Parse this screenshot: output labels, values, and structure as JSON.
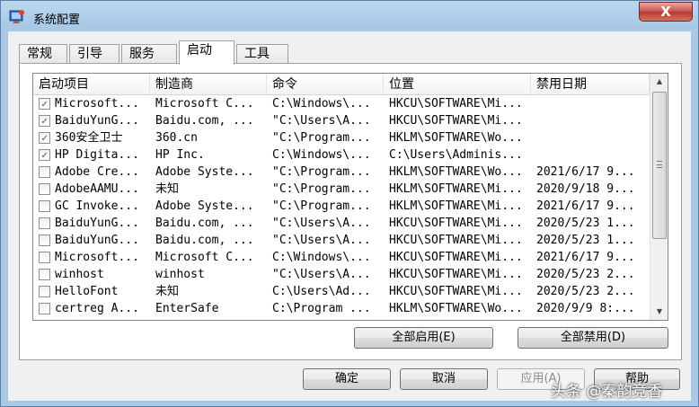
{
  "window": {
    "title": "系统配置",
    "close_glyph": "X"
  },
  "tabs": [
    "常规",
    "引导",
    "服务",
    "启动",
    "工具"
  ],
  "columns": [
    "启动项目",
    "制造商",
    "命令",
    "位置",
    "禁用日期"
  ],
  "rows": [
    {
      "checked": true,
      "cells": [
        "Microsoft...",
        "Microsoft C...",
        "C:\\Windows\\...",
        "HKCU\\SOFTWARE\\Mi...",
        ""
      ]
    },
    {
      "checked": true,
      "cells": [
        "BaiduYunG...",
        "Baidu.com, ...",
        "\"C:\\Users\\A...",
        "HKCU\\SOFTWARE\\Mi...",
        ""
      ]
    },
    {
      "checked": true,
      "cells": [
        "360安全卫士",
        "360.cn",
        "\"C:\\Program...",
        "HKLM\\SOFTWARE\\Wo...",
        ""
      ]
    },
    {
      "checked": true,
      "cells": [
        "HP Digita...",
        "HP Inc.",
        "C:\\Windows\\...",
        "C:\\Users\\Adminis...",
        ""
      ]
    },
    {
      "checked": false,
      "cells": [
        "Adobe Cre...",
        "Adobe Syste...",
        "\"C:\\Program...",
        "HKLM\\SOFTWARE\\Wo...",
        "2021/6/17 9..."
      ]
    },
    {
      "checked": false,
      "cells": [
        "AdobeAAMU...",
        "未知",
        "\"C:\\Program...",
        "HKLM\\SOFTWARE\\Mi...",
        "2020/9/18 9..."
      ]
    },
    {
      "checked": false,
      "cells": [
        "GC Invoke...",
        "Adobe Syste...",
        "\"C:\\Program...",
        "HKLM\\SOFTWARE\\Mi...",
        "2021/6/17 9..."
      ]
    },
    {
      "checked": false,
      "cells": [
        "BaiduYunG...",
        "Baidu.com, ...",
        "\"C:\\Users\\A...",
        "HKCU\\SOFTWARE\\Mi...",
        "2020/5/23 1..."
      ]
    },
    {
      "checked": false,
      "cells": [
        "BaiduYunG...",
        "Baidu.com, ...",
        "\"C:\\Users\\A...",
        "HKCU\\SOFTWARE\\Mi...",
        "2020/5/23 1..."
      ]
    },
    {
      "checked": false,
      "cells": [
        "Microsoft...",
        "Microsoft C...",
        "C:\\Windows\\...",
        "HKCU\\SOFTWARE\\Mi...",
        "2021/6/17 9..."
      ]
    },
    {
      "checked": false,
      "cells": [
        "winhost",
        "winhost",
        "\"C:\\Users\\A...",
        "HKCU\\SOFTWARE\\Mi...",
        "2020/5/23 2..."
      ]
    },
    {
      "checked": false,
      "cells": [
        "HelloFont",
        "未知",
        "C:\\Users\\Ad...",
        "HKCU\\SOFTWARE\\Mi...",
        "2020/5/23 2..."
      ]
    },
    {
      "checked": false,
      "cells": [
        "certreg A...",
        "EnterSafe",
        "C:\\Program ...",
        "HKLM\\SOFTWARE\\Wo...",
        "2020/9/9 8:..."
      ]
    }
  ],
  "buttons": {
    "enable_all": "全部启用(E)",
    "disable_all": "全部禁用(D)",
    "ok": "确定",
    "cancel": "取消",
    "apply": "应用(A)",
    "help": "帮助"
  },
  "watermark": "头条 @秦韵竞香",
  "icons": {
    "app": "msconfig-icon",
    "check": "✓",
    "scroll_up": "▲",
    "scroll_down": "▼"
  }
}
